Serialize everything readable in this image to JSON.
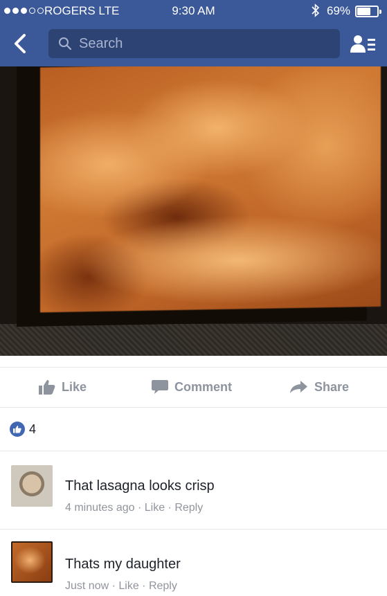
{
  "status_bar": {
    "carrier": "ROGERS  LTE",
    "time": "9:30 AM",
    "battery_percent": "69%",
    "battery_level": 0.69,
    "signal_bars_filled": 3,
    "signal_bars_total": 5
  },
  "nav": {
    "back_icon": "chevron-left-icon",
    "search_placeholder": "Search",
    "friends_icon": "friend-requests-icon"
  },
  "colors": {
    "header": "#3b5998",
    "search_field": "#2d4373",
    "action_gray": "#8d949e",
    "like_blue": "#4267b2"
  },
  "post": {
    "photo": "ultrasound image",
    "actions": {
      "like": "Like",
      "comment": "Comment",
      "share": "Share"
    },
    "reaction_count": "4"
  },
  "comments": [
    {
      "text": "That lasagna looks crisp",
      "time": "4 minutes ago",
      "like": "Like",
      "reply": "Reply"
    },
    {
      "text": "Thats my daughter",
      "time": "Just now",
      "like": "Like",
      "reply": "Reply"
    }
  ],
  "separator": " · "
}
